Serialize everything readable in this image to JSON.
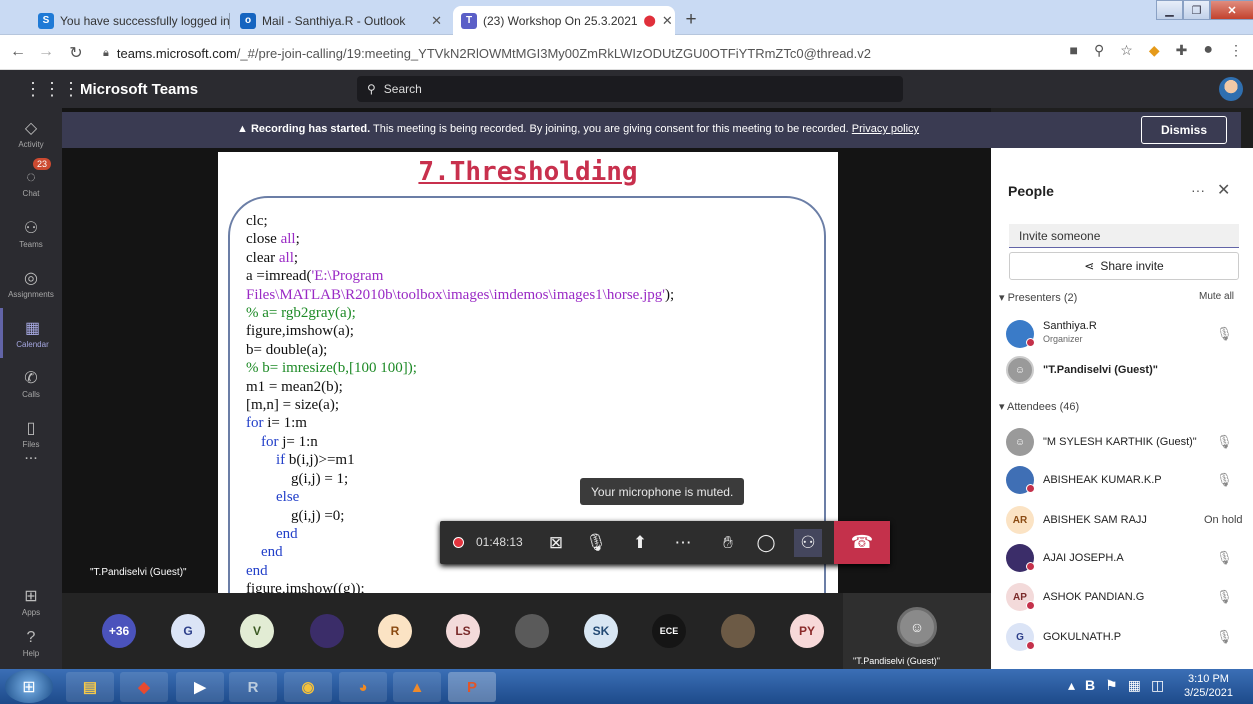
{
  "browser": {
    "tabs": [
      {
        "title": "You have successfully logged in.",
        "favicon": "S"
      },
      {
        "title": "Mail - Santhiya.R - Outlook",
        "favicon": "o"
      },
      {
        "title": "(23) Workshop On 25.3.2021",
        "favicon": "T"
      }
    ],
    "url_domain": "teams.microsoft.com",
    "url_path": "/_#/pre-join-calling/19:meeting_YTVkN2RlOWMtMGI3My00ZmRkLWIzODUtZGU0OTFiYTRmZTc0@thread.v2"
  },
  "teams": {
    "app_title": "Microsoft Teams",
    "search_placeholder": "Search"
  },
  "rail": {
    "items": [
      {
        "label": "Activity",
        "icon": "bell-icon"
      },
      {
        "label": "Chat",
        "icon": "chat-icon",
        "badge": "23"
      },
      {
        "label": "Teams",
        "icon": "teams-icon"
      },
      {
        "label": "Assignments",
        "icon": "assignments-icon"
      },
      {
        "label": "Calendar",
        "icon": "calendar-icon"
      },
      {
        "label": "Calls",
        "icon": "phone-icon"
      },
      {
        "label": "Files",
        "icon": "file-icon"
      },
      {
        "label": "...",
        "icon": "more-icon"
      },
      {
        "label": "Apps",
        "icon": "apps-icon"
      },
      {
        "label": "Help",
        "icon": "help-icon"
      }
    ]
  },
  "banner": {
    "bold": "Recording has started.",
    "text": " This meeting is being recorded. By joining, you are giving consent for this meeting to be recorded. ",
    "link": "Privacy policy",
    "dismiss": "Dismiss"
  },
  "slide": {
    "title": "7.Thresholding",
    "stage_label": "\"T.Pandiselvi (Guest)\""
  },
  "tooltip": "Your microphone is muted.",
  "controls": {
    "timer": "01:48:13"
  },
  "strip": {
    "participants": [
      {
        "label": "+36",
        "bg": "#4b53bc",
        "fg": "#ffffff"
      },
      {
        "label": "G",
        "bg": "#dbe4f6",
        "fg": "#2d3f8a"
      },
      {
        "label": "V",
        "bg": "#e2ecd4",
        "fg": "#3c5a23"
      },
      {
        "label": "",
        "bg": "#3b2d69",
        "fg": "#ffffff"
      },
      {
        "label": "R",
        "bg": "#fbe3c4",
        "fg": "#8a4a12"
      },
      {
        "label": "LS",
        "bg": "#f3dada",
        "fg": "#7a2a2a"
      },
      {
        "label": "",
        "bg": "#5a5a5a",
        "fg": "#ffffff"
      },
      {
        "label": "SK",
        "bg": "#d8e6f3",
        "fg": "#234a74"
      },
      {
        "label": "ECE",
        "bg": "#151515",
        "fg": "#ffffff"
      },
      {
        "label": "",
        "bg": "#6c5a45",
        "fg": "#ffffff"
      },
      {
        "label": "",
        "bg": "#9a8a7a",
        "fg": "#ffffff"
      },
      {
        "label": "PY",
        "bg": "#f7d9d9",
        "fg": "#8a2a2a"
      }
    ],
    "pinned_label": "\"T.Pandiselvi (Guest)\""
  },
  "people": {
    "title": "People",
    "invite_placeholder": "Invite someone",
    "share_invite": "Share invite",
    "presenters_header": "Presenters (2)",
    "mute_all": "Mute all",
    "presenters": [
      {
        "name": "Santhiya.R",
        "sub": "Organizer",
        "initials": "",
        "bg": "#3a7bc8",
        "fg": "#ffffff"
      },
      {
        "name": "\"T.Pandiselvi (Guest)\"",
        "sub": "",
        "initials": "",
        "bg": "#9a9a9a",
        "fg": "#ffffff"
      }
    ],
    "attendees_header": "Attendees (46)",
    "attendees": [
      {
        "name": "\"M SYLESH KARTHIK (Guest)\"",
        "initials": "",
        "bg": "#9a9a9a",
        "fg": "#ffffff",
        "status": ""
      },
      {
        "name": "ABISHEAK KUMAR.K.P",
        "initials": "",
        "bg": "#3f6fb5",
        "fg": "#ffffff",
        "status": ""
      },
      {
        "name": "ABISHEK SAM RAJJ",
        "initials": "AR",
        "bg": "#fbe3c4",
        "fg": "#8a4a12",
        "status": "On hold"
      },
      {
        "name": "AJAI JOSEPH.A",
        "initials": "",
        "bg": "#3b2d69",
        "fg": "#ffffff",
        "status": ""
      },
      {
        "name": "ASHOK PANDIAN.G",
        "initials": "AP",
        "bg": "#f3dada",
        "fg": "#7a2a2a",
        "status": ""
      },
      {
        "name": "GOKULNATH.P",
        "initials": "G",
        "bg": "#dbe4f6",
        "fg": "#2d3f8a",
        "status": ""
      }
    ]
  },
  "taskbar": {
    "time": "3:10 PM",
    "date": "3/25/2021"
  }
}
